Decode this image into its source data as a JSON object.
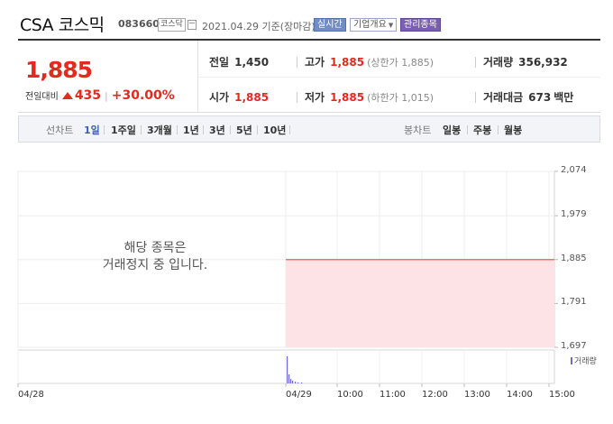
{
  "header": {
    "stock_name": "CSA 코스믹",
    "stock_code": "083660",
    "market": "코스닥",
    "date_text": "2021.04.29 기준(장마감)",
    "btn_realtime": "실시간",
    "btn_company": "기업개요",
    "btn_admin": "관리종목"
  },
  "quote": {
    "price": "1,885",
    "change_label": "전일대비",
    "change_value": "435",
    "change_pct": "+30.00%",
    "prev_close": {
      "label": "전일",
      "value": "1,450"
    },
    "high": {
      "label": "고가",
      "value": "1,885",
      "sub": "(상한가 1,885)"
    },
    "volume": {
      "label": "거래량",
      "value": "356,932"
    },
    "open": {
      "label": "시가",
      "value": "1,885"
    },
    "low": {
      "label": "저가",
      "value": "1,885",
      "sub": "(하한가 1,015)"
    },
    "turnover": {
      "label": "거래대금",
      "value": "673",
      "unit": "백만"
    }
  },
  "tabs": {
    "line_label": "선차트",
    "line_tabs": [
      "1일",
      "1주일",
      "3개월",
      "1년",
      "3년",
      "5년",
      "10년"
    ],
    "candle_label": "봉차트",
    "candle_tabs": [
      "일봉",
      "주봉",
      "월봉"
    ]
  },
  "chart_data": {
    "type": "area",
    "x": [
      "04/29",
      "10:00",
      "11:00",
      "12:00",
      "13:00",
      "14:00",
      "15:00"
    ],
    "values": [
      1885,
      1885,
      1885,
      1885,
      1885,
      1885,
      1885
    ],
    "yticks": [
      "2,074",
      "1,979",
      "1,885",
      "1,791",
      "1,697"
    ],
    "ylim": [
      1697,
      2074
    ],
    "xticks": [
      "04/28",
      "04/29",
      "10:00",
      "11:00",
      "12:00",
      "13:00",
      "14:00",
      "15:00"
    ],
    "halt_message_line1": "해당 종목은",
    "halt_message_line2": "거래정지 중 입니다.",
    "volume_legend": "거래량",
    "line_color": "#f07070",
    "fill_color": "#fde3e5",
    "volume_color": "#6b6bd6",
    "grid": true
  }
}
